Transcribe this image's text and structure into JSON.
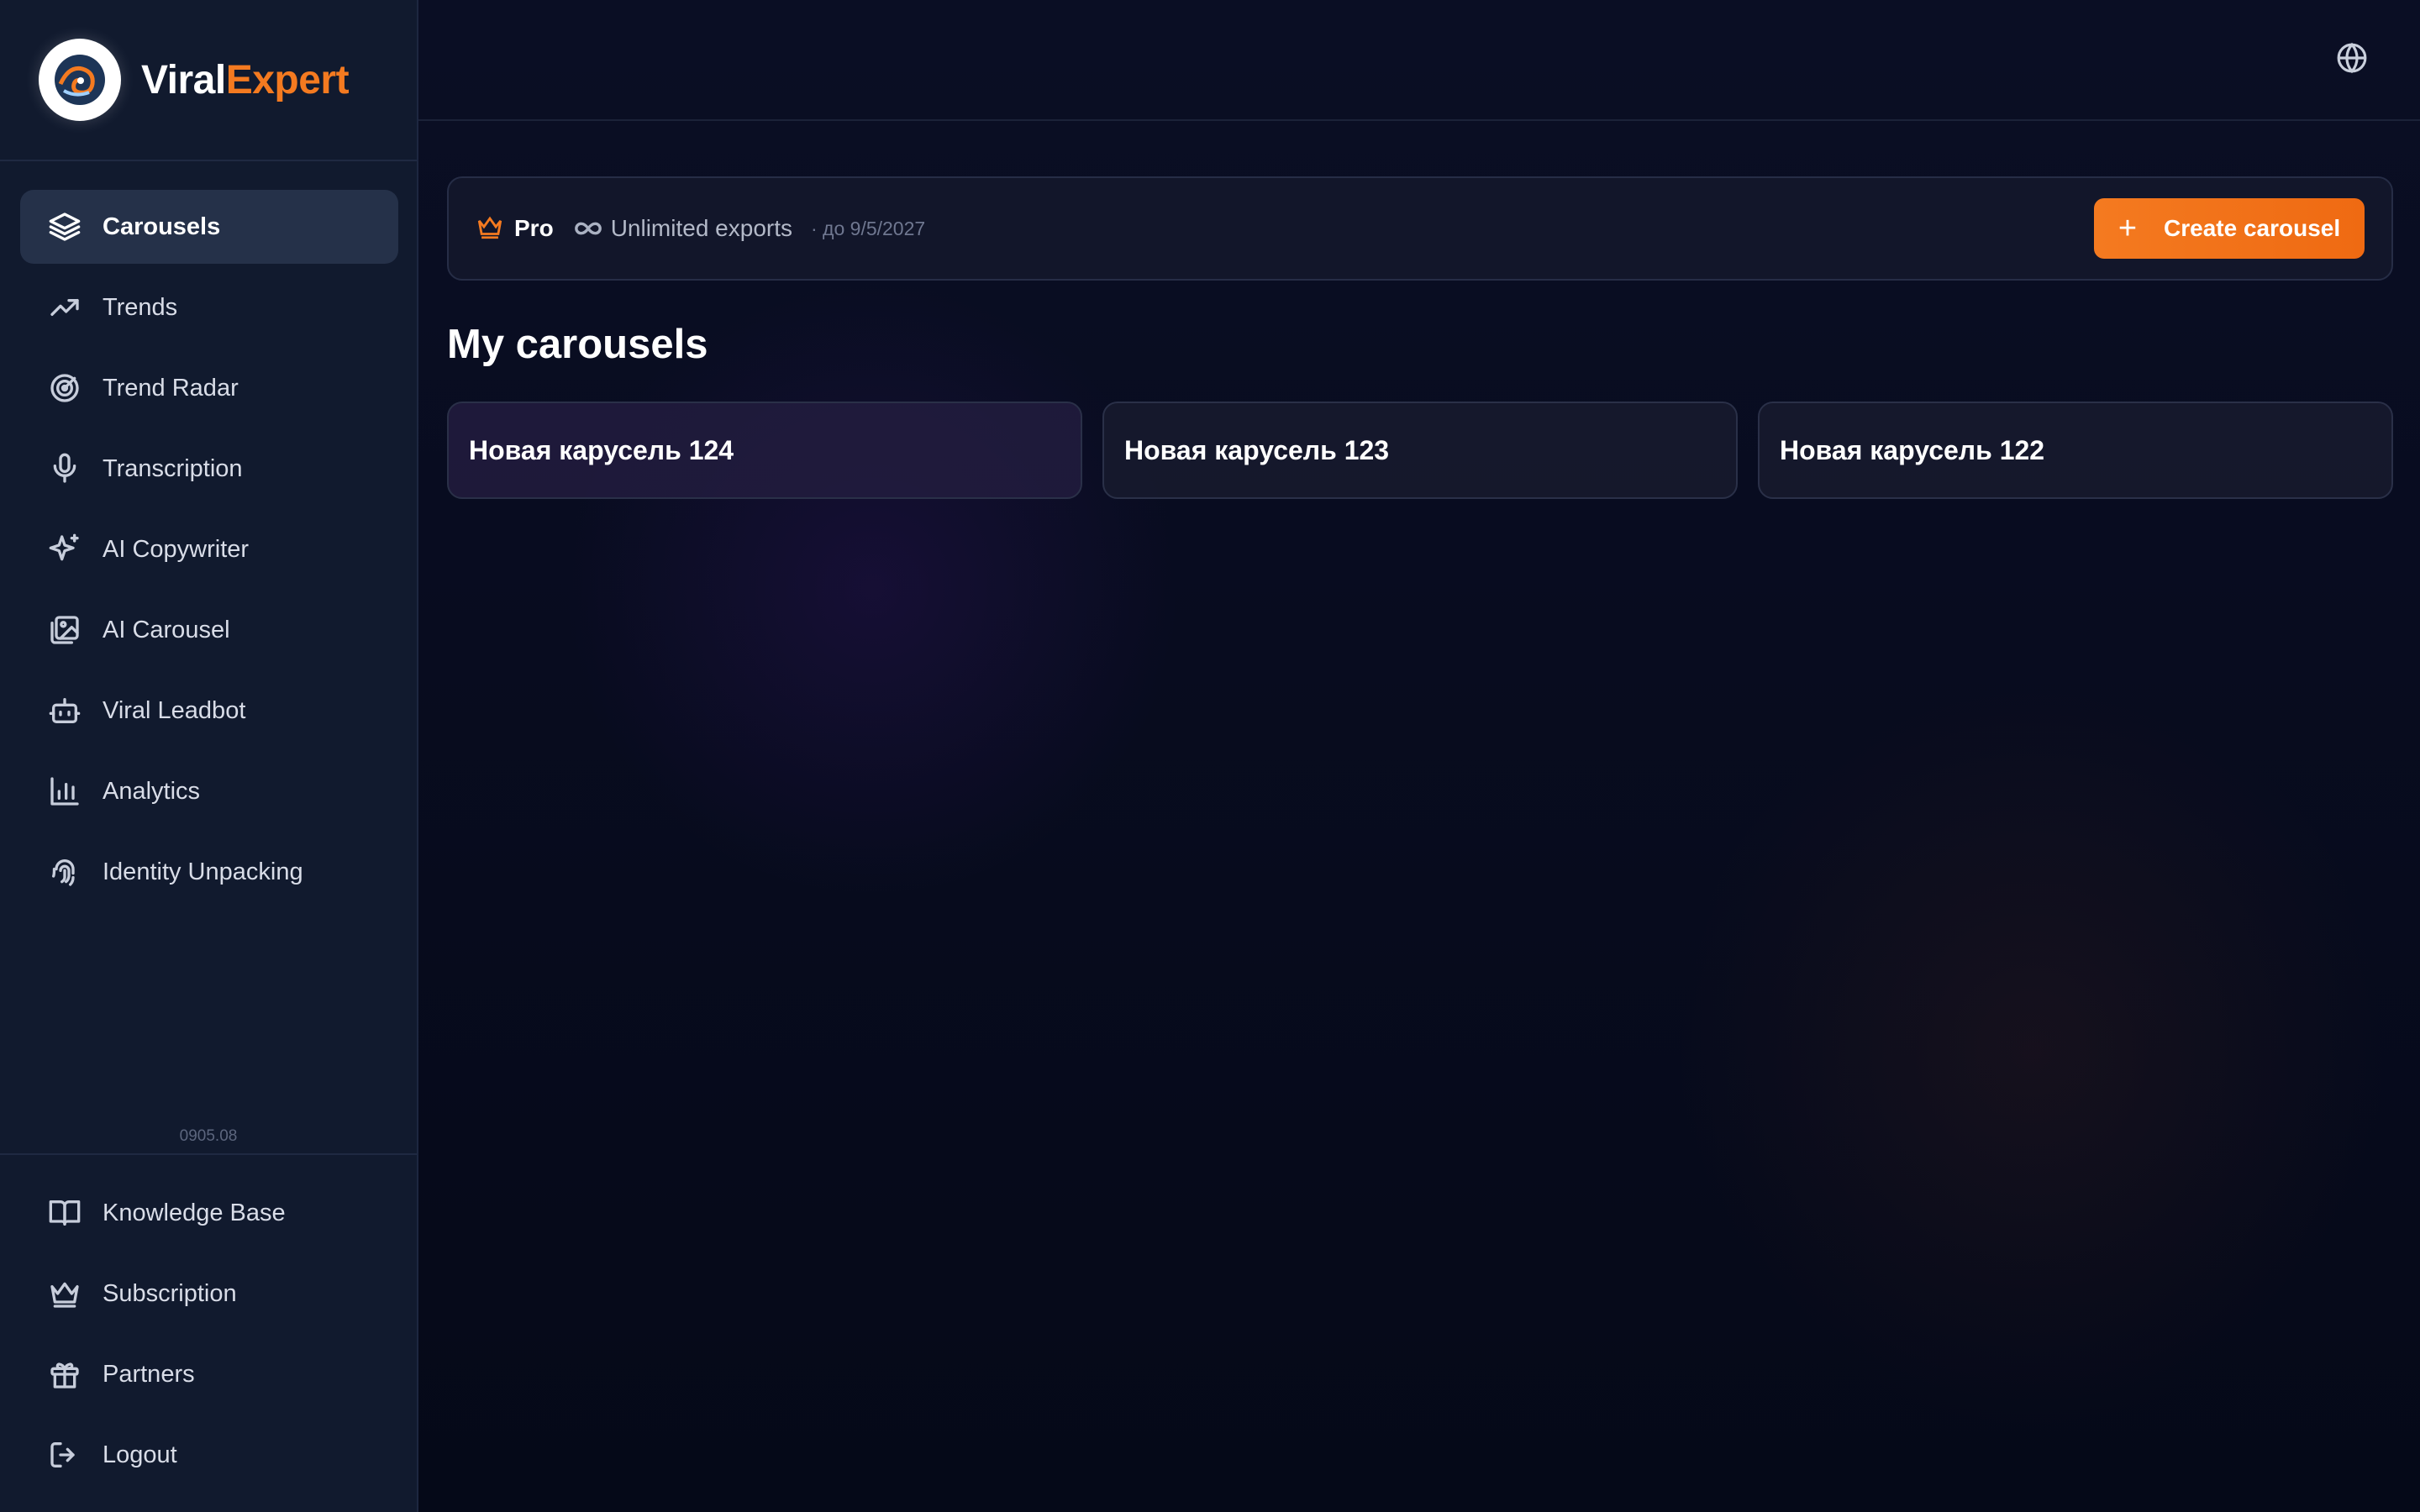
{
  "brand": {
    "name_part1": "Viral",
    "name_part2": "Expert",
    "accent_color": "#f47a20"
  },
  "sidebar": {
    "items": [
      {
        "label": "Carousels",
        "icon": "layers-icon",
        "active": true
      },
      {
        "label": "Trends",
        "icon": "trending-up-icon"
      },
      {
        "label": "Trend Radar",
        "icon": "radar-icon"
      },
      {
        "label": "Transcription",
        "icon": "microphone-icon"
      },
      {
        "label": "AI Copywriter",
        "icon": "sparkles-icon"
      },
      {
        "label": "AI Carousel",
        "icon": "images-icon"
      },
      {
        "label": "Viral Leadbot",
        "icon": "bot-icon"
      },
      {
        "label": "Analytics",
        "icon": "bar-chart-icon"
      },
      {
        "label": "Identity Unpacking",
        "icon": "fingerprint-icon"
      }
    ],
    "version": "0905.08",
    "bottom_items": [
      {
        "label": "Knowledge Base",
        "icon": "book-icon"
      },
      {
        "label": "Subscription",
        "icon": "crown-icon"
      },
      {
        "label": "Partners",
        "icon": "gift-icon"
      },
      {
        "label": "Logout",
        "icon": "logout-icon"
      }
    ]
  },
  "topbar": {
    "language_icon": "globe-icon"
  },
  "plan": {
    "name": "Pro",
    "feature": "Unlimited exports",
    "valid_until": "· до 9/5/2027",
    "create_button": "Create carousel"
  },
  "main": {
    "title": "My carousels",
    "carousels": [
      {
        "title": "Новая карусель 124"
      },
      {
        "title": "Новая карусель 123"
      },
      {
        "title": "Новая карусель 122"
      }
    ]
  }
}
